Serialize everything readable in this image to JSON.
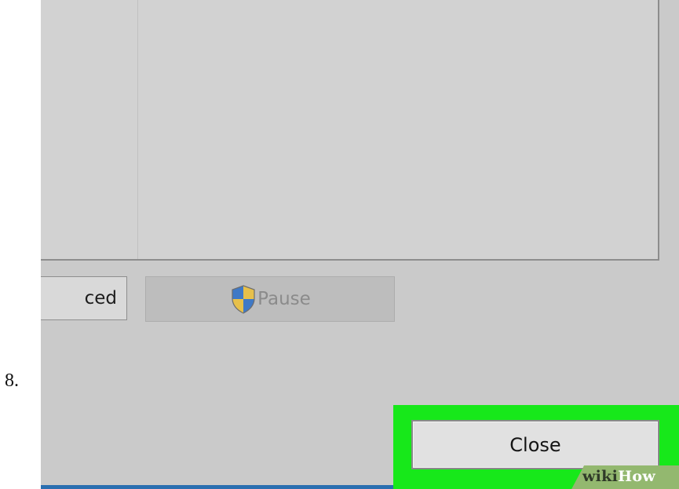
{
  "step": {
    "number": "8."
  },
  "dialog": {
    "buttons": {
      "advanced_label": "ced",
      "pause_label": "Pause",
      "pause_icon": "uac-shield-icon",
      "close_label": "Close"
    },
    "highlight_color": "#17e81a"
  },
  "watermark": {
    "wiki": "wiki",
    "how": "How"
  }
}
